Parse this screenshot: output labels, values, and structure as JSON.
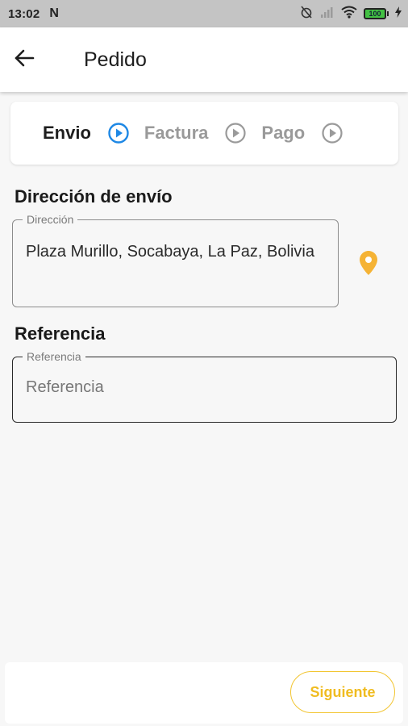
{
  "status_bar": {
    "time": "13:02",
    "notification_icon": "N",
    "battery": "100",
    "icons": [
      "alarm-off-icon",
      "signal-icon",
      "wifi-icon",
      "battery-icon",
      "charging-icon"
    ]
  },
  "app_bar": {
    "title": "Pedido",
    "back_icon": "arrow-left-icon"
  },
  "stepper": {
    "steps": [
      {
        "label": "Envio",
        "active": true
      },
      {
        "label": "Factura",
        "active": false
      },
      {
        "label": "Pago",
        "active": false
      }
    ],
    "active_color": "#1e88e5",
    "inactive_color": "#9a9a9a"
  },
  "shipping": {
    "title": "Dirección de envío",
    "address_label": "Dirección",
    "address_value": "Plaza Murillo, Socabaya, La Paz, Bolivia",
    "pin_color": "#f5b335"
  },
  "reference": {
    "title": "Referencia",
    "label": "Referencia",
    "placeholder": "Referencia"
  },
  "footer": {
    "next_label": "Siguiente",
    "accent_color": "#f2c531"
  }
}
